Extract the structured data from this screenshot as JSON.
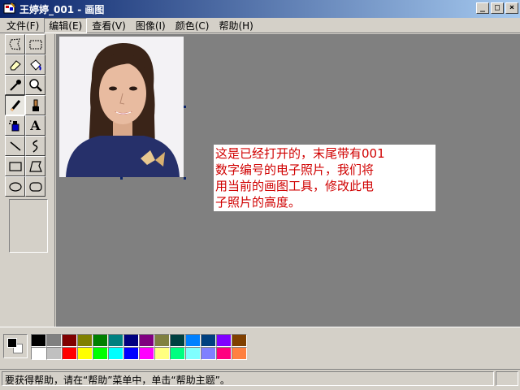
{
  "window": {
    "title": "王婷婷_001 - 画图",
    "minimize_glyph": "_",
    "maximize_glyph": "□",
    "close_glyph": "×"
  },
  "menu": [
    {
      "label": "文件(F)"
    },
    {
      "label": "编辑(E)"
    },
    {
      "label": "查看(V)"
    },
    {
      "label": "图像(I)"
    },
    {
      "label": "颜色(C)"
    },
    {
      "label": "帮助(H)"
    }
  ],
  "tools": [
    {
      "name": "free-form-select-icon"
    },
    {
      "name": "rect-select-icon"
    },
    {
      "name": "eraser-icon"
    },
    {
      "name": "fill-icon"
    },
    {
      "name": "color-picker-icon"
    },
    {
      "name": "magnifier-icon"
    },
    {
      "name": "pencil-icon",
      "active": true
    },
    {
      "name": "brush-icon"
    },
    {
      "name": "airbrush-icon"
    },
    {
      "name": "text-icon",
      "glyph": "A"
    },
    {
      "name": "line-icon"
    },
    {
      "name": "curve-icon"
    },
    {
      "name": "rectangle-icon"
    },
    {
      "name": "polygon-icon"
    },
    {
      "name": "ellipse-icon"
    },
    {
      "name": "rounded-rectangle-icon"
    }
  ],
  "canvas": {
    "note": "这是已经打开的，末尾带有001\n数字编号的电子照片，我们将\n用当前的画图工具，修改此电\n子照片的高度。",
    "note_color": "#d00000",
    "background": "#808080"
  },
  "palette": {
    "foreground": "#000000",
    "background": "#ffffff",
    "row1": [
      "#000000",
      "#808080",
      "#800000",
      "#808000",
      "#008000",
      "#008080",
      "#000080",
      "#800080",
      "#808040",
      "#004040",
      "#0080ff",
      "#004080",
      "#8000ff",
      "#804000"
    ],
    "row2": [
      "#ffffff",
      "#c0c0c0",
      "#ff0000",
      "#ffff00",
      "#00ff00",
      "#00ffff",
      "#0000ff",
      "#ff00ff",
      "#ffff80",
      "#00ff80",
      "#80ffff",
      "#8080ff",
      "#ff0080",
      "#ff8040"
    ]
  },
  "status": {
    "text": "要获得帮助，请在“帮助”菜单中，单击“帮助主题”。"
  }
}
